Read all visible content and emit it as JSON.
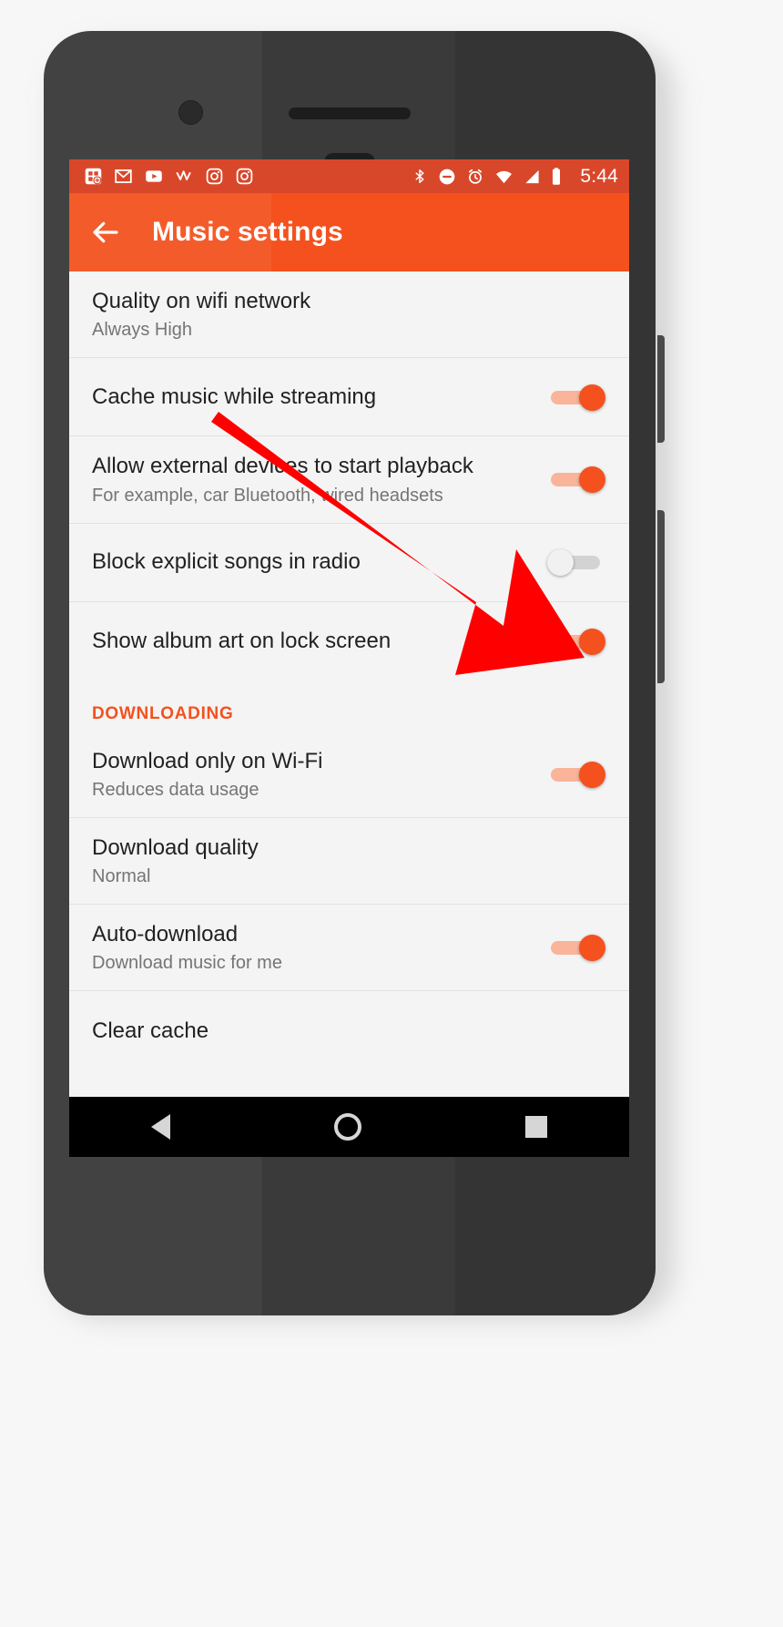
{
  "device": {
    "platform": "Android",
    "navbar": {
      "back": "back-triangle",
      "home": "home-circle",
      "recents": "recents-square"
    }
  },
  "statusbar": {
    "time": "5:44",
    "left_icons": [
      {
        "name": "play-store-notification-icon",
        "label": "Play Store"
      },
      {
        "name": "gmail-icon",
        "label": "Gmail"
      },
      {
        "name": "youtube-icon",
        "label": "YouTube"
      },
      {
        "name": "strava-icon",
        "label": "Strava"
      },
      {
        "name": "instagram-icon",
        "label": "Instagram"
      },
      {
        "name": "instagram-icon-2",
        "label": "Instagram"
      }
    ],
    "right_icons": [
      {
        "name": "bluetooth-icon",
        "label": "Bluetooth"
      },
      {
        "name": "do-not-disturb-icon",
        "label": "Do not disturb"
      },
      {
        "name": "alarm-icon",
        "label": "Alarm set"
      },
      {
        "name": "wifi-icon",
        "label": "Wi-Fi"
      },
      {
        "name": "cellular-signal-icon",
        "label": "Cellular signal"
      },
      {
        "name": "battery-icon",
        "label": "Battery"
      }
    ],
    "background": "#d9472a"
  },
  "appbar": {
    "title": "Music settings",
    "back_icon": "back-arrow-icon",
    "background": "#f4511e"
  },
  "settings": {
    "items": [
      {
        "id": "quality-on-wifi-network",
        "title": "Quality on wifi network",
        "subtitle": "Always High",
        "control": "none"
      },
      {
        "id": "cache-music-while-streaming",
        "title": "Cache music while streaming",
        "subtitle": "",
        "control": "switch",
        "state": "on"
      },
      {
        "id": "allow-external-devices-to-start-playback",
        "title": "Allow external devices to start playback",
        "subtitle": "For example, car Bluetooth, wired headsets",
        "control": "switch",
        "state": "on"
      },
      {
        "id": "block-explicit-songs-in-radio",
        "title": "Block explicit songs in radio",
        "subtitle": "",
        "control": "switch",
        "state": "off"
      },
      {
        "id": "show-album-art-on-lock-screen",
        "title": "Show album art on lock screen",
        "subtitle": "",
        "control": "switch",
        "state": "on"
      }
    ],
    "section_downloading": {
      "header": "DOWNLOADING",
      "header_color": "#f4511e",
      "items": [
        {
          "id": "download-only-on-wifi",
          "title": "Download only on Wi-Fi",
          "subtitle": "Reduces data usage",
          "control": "switch",
          "state": "on"
        },
        {
          "id": "download-quality",
          "title": "Download quality",
          "subtitle": "Normal",
          "control": "none"
        },
        {
          "id": "auto-download",
          "title": "Auto-download",
          "subtitle": "Download music for me",
          "control": "switch",
          "state": "on"
        },
        {
          "id": "clear-cache",
          "title": "Clear cache",
          "subtitle": "",
          "control": "none"
        }
      ]
    }
  },
  "annotation": {
    "type": "arrow",
    "color": "#ff0000",
    "points_to": "show-album-art-on-lock-screen-switch"
  },
  "colors": {
    "accent": "#f4511e",
    "statusbar": "#d9472a",
    "screen_bg": "#f4f4f4",
    "title_text": "#212121",
    "subtitle_text": "#757575",
    "switch_on_track": "#f9b49a",
    "switch_off_track": "#d3d3d3"
  }
}
